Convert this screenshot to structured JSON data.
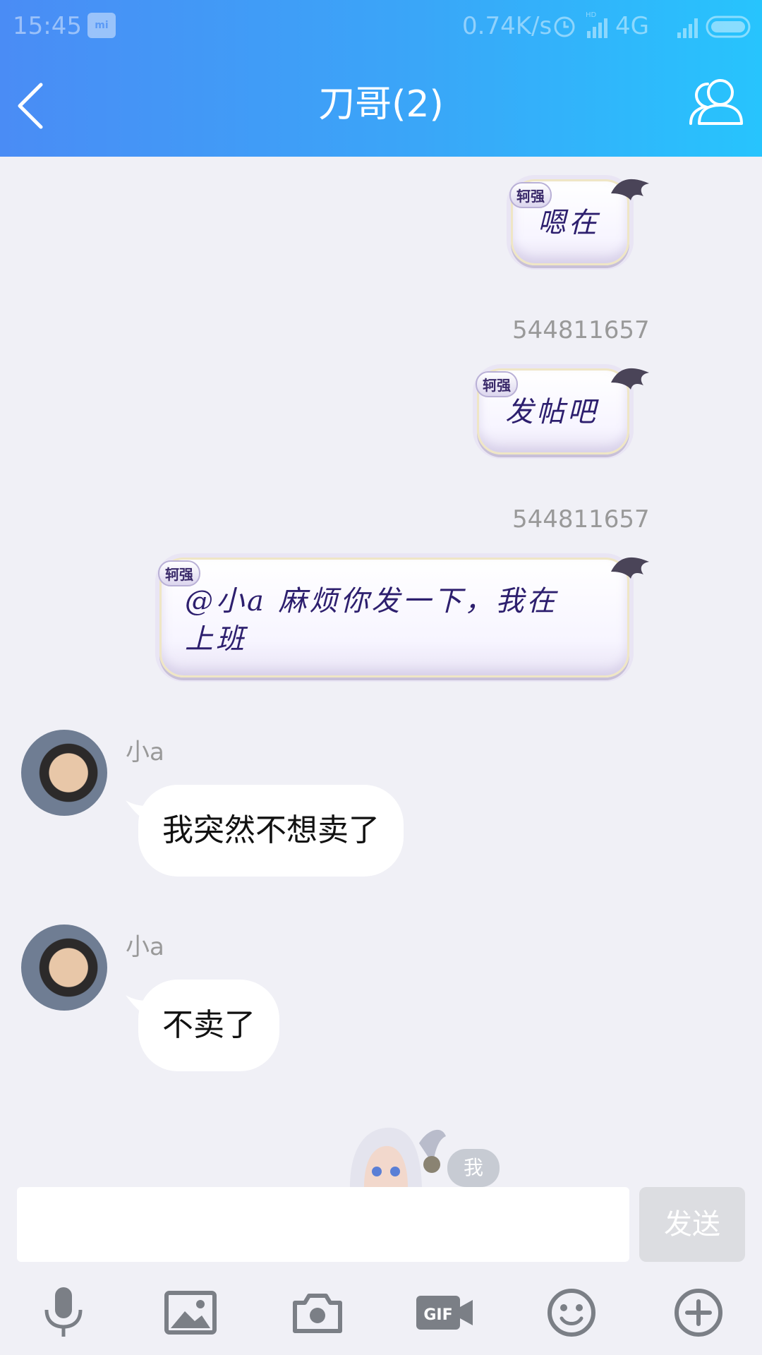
{
  "status_bar": {
    "time": "15:45",
    "mi_label": "mi",
    "net_speed": "0.74K/s",
    "network": "4G"
  },
  "header": {
    "title": "刀哥(2)"
  },
  "messages": [
    {
      "side": "right",
      "tag": "轲强",
      "text": "嗯在"
    },
    {
      "side": "right",
      "sender": "544811657",
      "tag": "轲强",
      "text": "发帖吧"
    },
    {
      "side": "right",
      "sender": "544811657",
      "tag": "轲强",
      "text_line1": "@小a 麻烦你发一下，我在",
      "text_line2": "上班"
    },
    {
      "side": "left",
      "sender": "小a",
      "text": "我突然不想卖了"
    },
    {
      "side": "left",
      "sender": "小a",
      "text": "不卖了"
    }
  ],
  "me_badge": "我",
  "input": {
    "value": "",
    "send_label": "发送"
  },
  "toolbar": {
    "gif_label": "GIF"
  },
  "colors": {
    "header_start": "#4a8cf5",
    "header_end": "#27c4fd",
    "background": "#f0f0f6",
    "theme_text": "#2d1f6e"
  },
  "icons": [
    "back-arrow-icon",
    "contacts-icon",
    "microphone-icon",
    "image-icon",
    "camera-icon",
    "gif-icon",
    "emoji-icon",
    "plus-icon"
  ]
}
